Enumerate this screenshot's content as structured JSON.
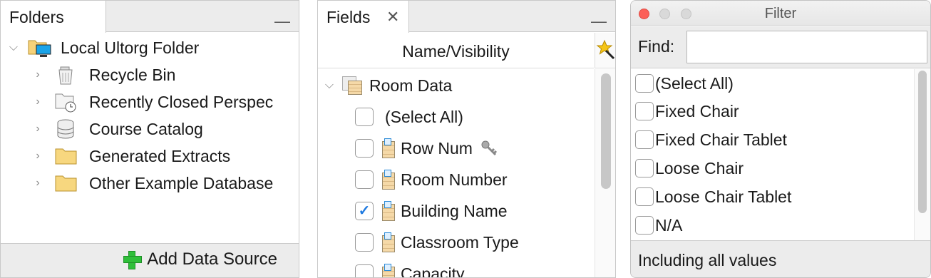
{
  "folders": {
    "tab_label": "Folders",
    "minimize_label": "—",
    "root": {
      "label": "Local Ultorg Folder",
      "icon": "local-folder-icon"
    },
    "items": [
      {
        "label": "Recycle Bin",
        "icon": "recycle-bin-icon"
      },
      {
        "label": "Recently Closed Perspec",
        "icon": "recent-folder-icon"
      },
      {
        "label": "Course Catalog",
        "icon": "database-icon"
      },
      {
        "label": "Generated Extracts",
        "icon": "folder-icon"
      },
      {
        "label": "Other Example Database",
        "icon": "folder-icon"
      }
    ],
    "add_data_source_label": "Add Data Source"
  },
  "fields": {
    "tab_label": "Fields",
    "close_label": "✕",
    "minimize_label": "—",
    "column_header": "Name/Visibility",
    "table": {
      "label": "Room Data"
    },
    "select_all_label": "(Select All)",
    "rows": [
      {
        "label": "Row Num",
        "checked": false,
        "has_key": true
      },
      {
        "label": "Room Number",
        "checked": false
      },
      {
        "label": "Building Name",
        "checked": true
      },
      {
        "label": "Classroom Type",
        "checked": false
      },
      {
        "label": "Capacity",
        "checked": false
      }
    ]
  },
  "filter": {
    "title": "Filter",
    "find_label": "Find:",
    "find_value": "",
    "options": [
      "(Select All)",
      "Fixed Chair",
      "Fixed Chair Tablet",
      "Loose Chair",
      "Loose Chair Tablet",
      "N/A"
    ],
    "status": "Including all values"
  },
  "colors": {
    "panel_header_bg": "#ececec",
    "checkmark": "#1f7ae0",
    "plus": "#2fbf3a",
    "close_button": "#fc5f57"
  }
}
